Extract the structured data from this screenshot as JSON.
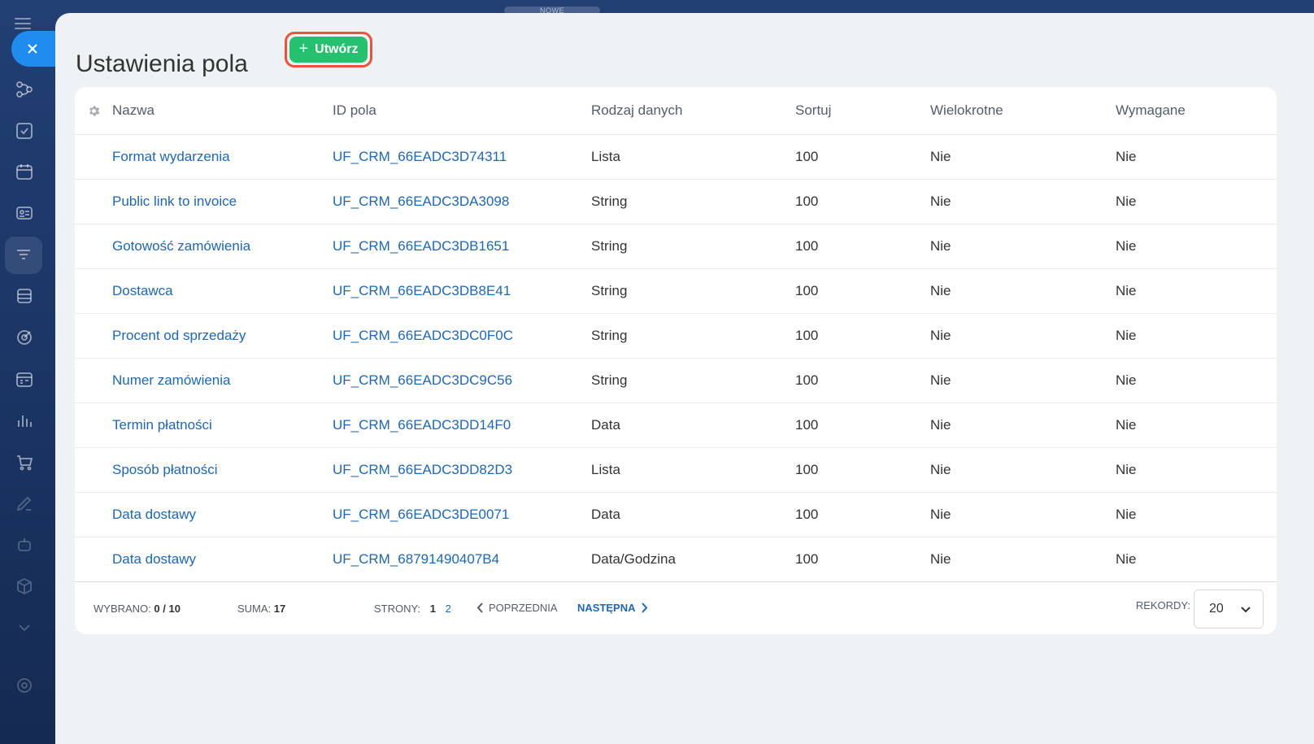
{
  "topbar": {
    "label": "NOWE"
  },
  "page": {
    "title": "Ustawienia pola",
    "create_label": "Utwórz"
  },
  "table": {
    "headers": [
      "Nazwa",
      "ID pola",
      "Rodzaj danych",
      "Sortuj",
      "Wielokrotne",
      "Wymagane"
    ],
    "rows": [
      {
        "name": "Format wydarzenia",
        "id": "UF_CRM_66EADC3D74311",
        "type": "Lista",
        "sort": "100",
        "multiple": "Nie",
        "required": "Nie"
      },
      {
        "name": "Public link to invoice",
        "id": "UF_CRM_66EADC3DA3098",
        "type": "String",
        "sort": "100",
        "multiple": "Nie",
        "required": "Nie"
      },
      {
        "name": "Gotowość zamówienia",
        "id": "UF_CRM_66EADC3DB1651",
        "type": "String",
        "sort": "100",
        "multiple": "Nie",
        "required": "Nie"
      },
      {
        "name": "Dostawca",
        "id": "UF_CRM_66EADC3DB8E41",
        "type": "String",
        "sort": "100",
        "multiple": "Nie",
        "required": "Nie"
      },
      {
        "name": "Procent od sprzedaży",
        "id": "UF_CRM_66EADC3DC0F0C",
        "type": "String",
        "sort": "100",
        "multiple": "Nie",
        "required": "Nie"
      },
      {
        "name": "Numer zamówienia",
        "id": "UF_CRM_66EADC3DC9C56",
        "type": "String",
        "sort": "100",
        "multiple": "Nie",
        "required": "Nie"
      },
      {
        "name": "Termin płatności",
        "id": "UF_CRM_66EADC3DD14F0",
        "type": "Data",
        "sort": "100",
        "multiple": "Nie",
        "required": "Nie"
      },
      {
        "name": "Sposób płatności",
        "id": "UF_CRM_66EADC3DD82D3",
        "type": "Lista",
        "sort": "100",
        "multiple": "Nie",
        "required": "Nie"
      },
      {
        "name": "Data dostawy",
        "id": "UF_CRM_66EADC3DE0071",
        "type": "Data",
        "sort": "100",
        "multiple": "Nie",
        "required": "Nie"
      },
      {
        "name": "Data dostawy",
        "id": "UF_CRM_68791490407B4",
        "type": "Data/Godzina",
        "sort": "100",
        "multiple": "Nie",
        "required": "Nie"
      }
    ]
  },
  "footer": {
    "selected_label": "WYBRANO:",
    "selected_value": "0 / 10",
    "total_label": "SUMA:",
    "total_value": "17",
    "pages_label": "STRONY:",
    "pages": [
      "1",
      "2"
    ],
    "prev_label": "POPRZEDNIA",
    "next_label": "NASTĘPNA",
    "records_label": "REKORDY:",
    "records_value": "20"
  },
  "colors": {
    "accent_green": "#25c16f",
    "highlight_border": "#e8553a",
    "link_blue": "#2067b0",
    "close_blue": "#1f8cf0"
  },
  "icons": {
    "sidebar": [
      "menu-icon",
      "close-icon",
      "flow-icon",
      "task-icon",
      "calendar-icon",
      "contact-card-icon",
      "funnel-icon",
      "inbox-icon",
      "target-icon",
      "schedule-icon",
      "chart-icon",
      "cart-icon",
      "sign-icon",
      "robot-icon",
      "box-icon",
      "chevron-down-icon",
      "settings-icon"
    ]
  }
}
